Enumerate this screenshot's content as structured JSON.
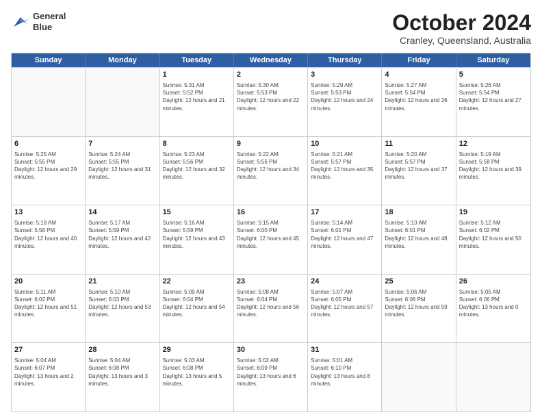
{
  "header": {
    "logo_line1": "General",
    "logo_line2": "Blue",
    "month": "October 2024",
    "location": "Cranley, Queensland, Australia"
  },
  "weekdays": [
    "Sunday",
    "Monday",
    "Tuesday",
    "Wednesday",
    "Thursday",
    "Friday",
    "Saturday"
  ],
  "weeks": [
    [
      {
        "day": "",
        "empty": true
      },
      {
        "day": "",
        "empty": true
      },
      {
        "day": "1",
        "sunrise": "5:31 AM",
        "sunset": "5:52 PM",
        "daylight": "12 hours and 21 minutes."
      },
      {
        "day": "2",
        "sunrise": "5:30 AM",
        "sunset": "5:53 PM",
        "daylight": "12 hours and 22 minutes."
      },
      {
        "day": "3",
        "sunrise": "5:29 AM",
        "sunset": "5:53 PM",
        "daylight": "12 hours and 24 minutes."
      },
      {
        "day": "4",
        "sunrise": "5:27 AM",
        "sunset": "5:54 PM",
        "daylight": "12 hours and 26 minutes."
      },
      {
        "day": "5",
        "sunrise": "5:26 AM",
        "sunset": "5:54 PM",
        "daylight": "12 hours and 27 minutes."
      }
    ],
    [
      {
        "day": "6",
        "sunrise": "5:25 AM",
        "sunset": "5:55 PM",
        "daylight": "12 hours and 29 minutes."
      },
      {
        "day": "7",
        "sunrise": "5:24 AM",
        "sunset": "5:55 PM",
        "daylight": "12 hours and 31 minutes."
      },
      {
        "day": "8",
        "sunrise": "5:23 AM",
        "sunset": "5:56 PM",
        "daylight": "12 hours and 32 minutes."
      },
      {
        "day": "9",
        "sunrise": "5:22 AM",
        "sunset": "5:56 PM",
        "daylight": "12 hours and 34 minutes."
      },
      {
        "day": "10",
        "sunrise": "5:21 AM",
        "sunset": "5:57 PM",
        "daylight": "12 hours and 35 minutes."
      },
      {
        "day": "11",
        "sunrise": "5:20 AM",
        "sunset": "5:57 PM",
        "daylight": "12 hours and 37 minutes."
      },
      {
        "day": "12",
        "sunrise": "5:19 AM",
        "sunset": "5:58 PM",
        "daylight": "12 hours and 39 minutes."
      }
    ],
    [
      {
        "day": "13",
        "sunrise": "5:18 AM",
        "sunset": "5:58 PM",
        "daylight": "12 hours and 40 minutes."
      },
      {
        "day": "14",
        "sunrise": "5:17 AM",
        "sunset": "5:59 PM",
        "daylight": "12 hours and 42 minutes."
      },
      {
        "day": "15",
        "sunrise": "5:16 AM",
        "sunset": "5:59 PM",
        "daylight": "12 hours and 43 minutes."
      },
      {
        "day": "16",
        "sunrise": "5:15 AM",
        "sunset": "6:00 PM",
        "daylight": "12 hours and 45 minutes."
      },
      {
        "day": "17",
        "sunrise": "5:14 AM",
        "sunset": "6:01 PM",
        "daylight": "12 hours and 47 minutes."
      },
      {
        "day": "18",
        "sunrise": "5:13 AM",
        "sunset": "6:01 PM",
        "daylight": "12 hours and 48 minutes."
      },
      {
        "day": "19",
        "sunrise": "5:12 AM",
        "sunset": "6:02 PM",
        "daylight": "12 hours and 50 minutes."
      }
    ],
    [
      {
        "day": "20",
        "sunrise": "5:11 AM",
        "sunset": "6:02 PM",
        "daylight": "12 hours and 51 minutes."
      },
      {
        "day": "21",
        "sunrise": "5:10 AM",
        "sunset": "6:03 PM",
        "daylight": "12 hours and 53 minutes."
      },
      {
        "day": "22",
        "sunrise": "5:09 AM",
        "sunset": "6:04 PM",
        "daylight": "12 hours and 54 minutes."
      },
      {
        "day": "23",
        "sunrise": "5:08 AM",
        "sunset": "6:04 PM",
        "daylight": "12 hours and 56 minutes."
      },
      {
        "day": "24",
        "sunrise": "5:07 AM",
        "sunset": "6:05 PM",
        "daylight": "12 hours and 57 minutes."
      },
      {
        "day": "25",
        "sunrise": "5:06 AM",
        "sunset": "6:06 PM",
        "daylight": "12 hours and 59 minutes."
      },
      {
        "day": "26",
        "sunrise": "5:05 AM",
        "sunset": "6:06 PM",
        "daylight": "13 hours and 0 minutes."
      }
    ],
    [
      {
        "day": "27",
        "sunrise": "5:04 AM",
        "sunset": "6:07 PM",
        "daylight": "13 hours and 2 minutes."
      },
      {
        "day": "28",
        "sunrise": "5:04 AM",
        "sunset": "6:08 PM",
        "daylight": "13 hours and 3 minutes."
      },
      {
        "day": "29",
        "sunrise": "5:03 AM",
        "sunset": "6:08 PM",
        "daylight": "13 hours and 5 minutes."
      },
      {
        "day": "30",
        "sunrise": "5:02 AM",
        "sunset": "6:09 PM",
        "daylight": "13 hours and 6 minutes."
      },
      {
        "day": "31",
        "sunrise": "5:01 AM",
        "sunset": "6:10 PM",
        "daylight": "13 hours and 8 minutes."
      },
      {
        "day": "",
        "empty": true
      },
      {
        "day": "",
        "empty": true
      }
    ]
  ]
}
